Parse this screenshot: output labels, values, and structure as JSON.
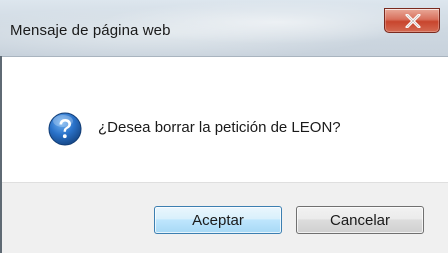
{
  "window": {
    "title": "Mensaje de página web",
    "close_icon": "close-icon"
  },
  "message": {
    "icon": "question-icon",
    "text": "¿Desea borrar la petición de LEON?"
  },
  "buttons": {
    "accept_label": "Aceptar",
    "cancel_label": "Cancelar"
  },
  "colors": {
    "icon_blue": "#1e63b8",
    "close_red": "#c8452d",
    "default_button_border": "#3c7fb1"
  }
}
